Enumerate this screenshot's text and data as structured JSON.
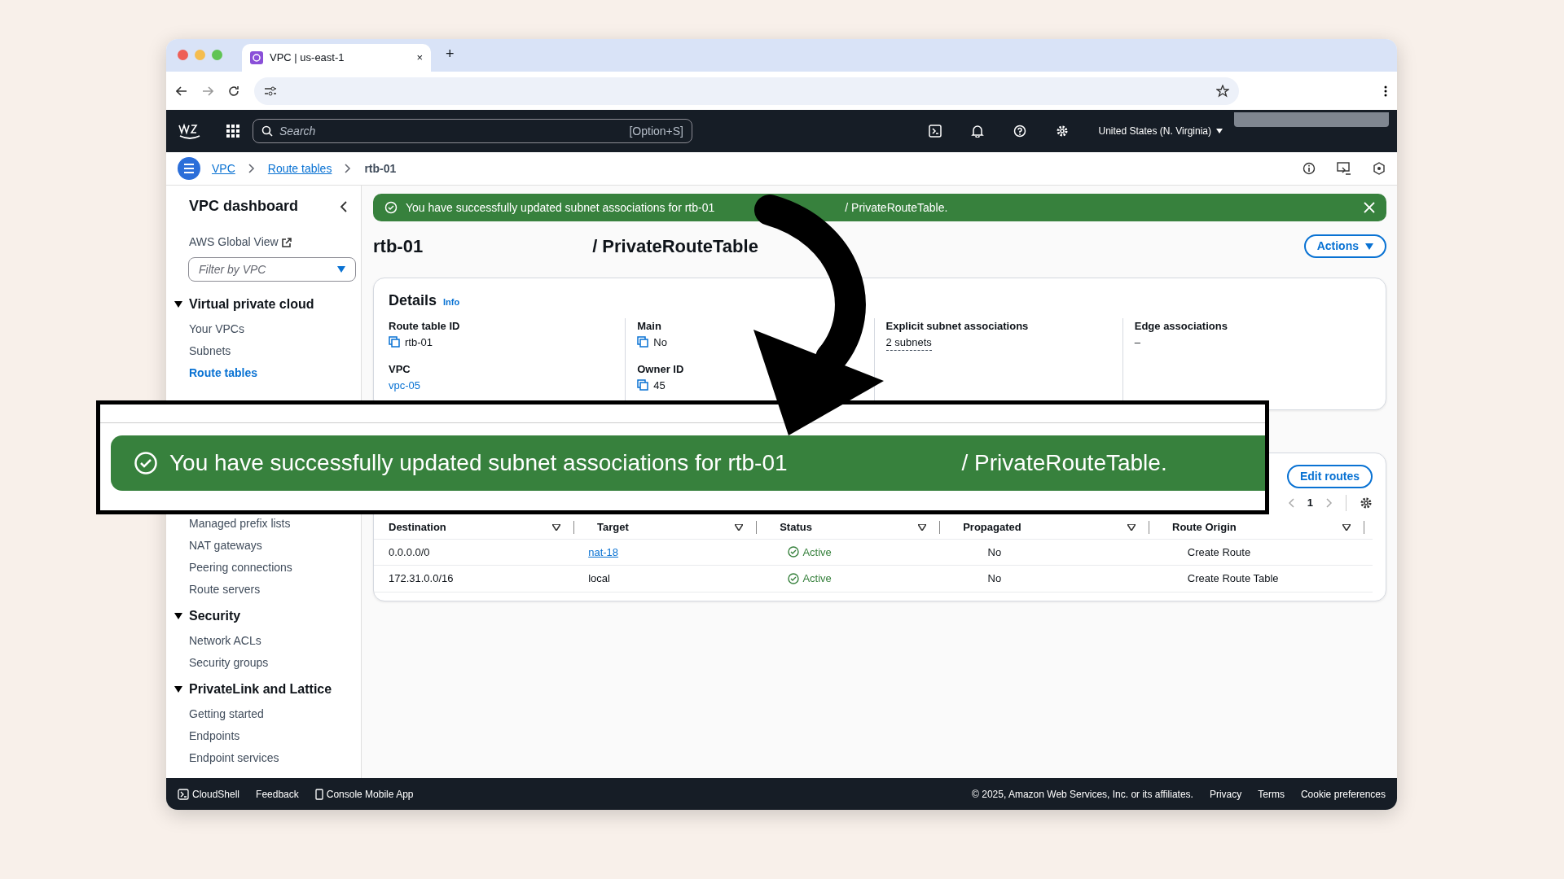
{
  "browser": {
    "tab_title": "VPC | us-east-1",
    "new_tab": "+",
    "close_tab": "×"
  },
  "console_header": {
    "search_placeholder": "Search",
    "shortcut": "[Option+S]",
    "region": "United States (N. Virginia)"
  },
  "breadcrumbs": [
    {
      "label": "VPC",
      "link": true
    },
    {
      "label": "Route tables",
      "link": true
    },
    {
      "label": "rtb-01",
      "link": false
    }
  ],
  "sidebar": {
    "title": "VPC dashboard",
    "global_view": "AWS Global View",
    "filter_placeholder": "Filter by VPC",
    "sections": [
      {
        "title": "Virtual private cloud",
        "expanded": true,
        "items": [
          {
            "label": "Your VPCs",
            "selected": false
          },
          {
            "label": "Subnets",
            "selected": false
          },
          {
            "label": "Route tables",
            "selected": true
          },
          {
            "label": "Managed prefix lists",
            "selected": false
          },
          {
            "label": "NAT gateways",
            "selected": false
          },
          {
            "label": "Peering connections",
            "selected": false
          },
          {
            "label": "Route servers",
            "selected": false
          }
        ]
      },
      {
        "title": "Security",
        "expanded": true,
        "items": [
          {
            "label": "Network ACLs",
            "selected": false
          },
          {
            "label": "Security groups",
            "selected": false
          }
        ]
      },
      {
        "title": "PrivateLink and Lattice",
        "expanded": true,
        "items": [
          {
            "label": "Getting started",
            "selected": false
          },
          {
            "label": "Endpoints",
            "selected": false
          },
          {
            "label": "Endpoint services",
            "selected": false
          }
        ]
      }
    ]
  },
  "flash": {
    "message": "You have successfully updated subnet associations for rtb-01",
    "suffix": "/ PrivateRouteTable."
  },
  "page": {
    "id": "rtb-01",
    "name": "/ PrivateRouteTable",
    "actions": "Actions"
  },
  "details": {
    "title": "Details",
    "info": "Info",
    "columns": [
      {
        "fields": [
          {
            "label": "Route table ID",
            "value": "rtb-01",
            "kind": "copy"
          },
          {
            "label": "VPC",
            "value": "vpc-05",
            "kind": "link"
          }
        ]
      },
      {
        "fields": [
          {
            "label": "Main",
            "value": "No",
            "kind": "copy"
          },
          {
            "label": "Owner ID",
            "value": "45",
            "kind": "copy"
          }
        ]
      },
      {
        "fields": [
          {
            "label": "Explicit subnet associations",
            "value": "2 subnets",
            "kind": "dotted"
          }
        ]
      },
      {
        "fields": [
          {
            "label": "Edge associations",
            "value": "–",
            "kind": "text"
          }
        ]
      }
    ]
  },
  "routes": {
    "edit": "Edit routes",
    "page": "1",
    "columns": [
      "Destination",
      "Target",
      "Status",
      "Propagated",
      "Route Origin"
    ],
    "rows": [
      {
        "destination": "0.0.0.0/0",
        "target": {
          "label": "nat-18",
          "kind": "link"
        },
        "status": "Active",
        "propagated": "No",
        "origin": "Create Route"
      },
      {
        "destination": "172.31.0.0/16",
        "target": {
          "label": "local",
          "kind": "text"
        },
        "status": "Active",
        "propagated": "No",
        "origin": "Create Route Table"
      }
    ]
  },
  "callout": {
    "message": "You have successfully updated subnet associations for rtb-01",
    "suffix": "/ PrivateRouteTable."
  },
  "footer": {
    "left": [
      "CloudShell",
      "Feedback",
      "Console Mobile App"
    ],
    "copyright": "© 2025, Amazon Web Services, Inc. or its affiliates.",
    "links": [
      "Privacy",
      "Terms",
      "Cookie preferences"
    ]
  }
}
